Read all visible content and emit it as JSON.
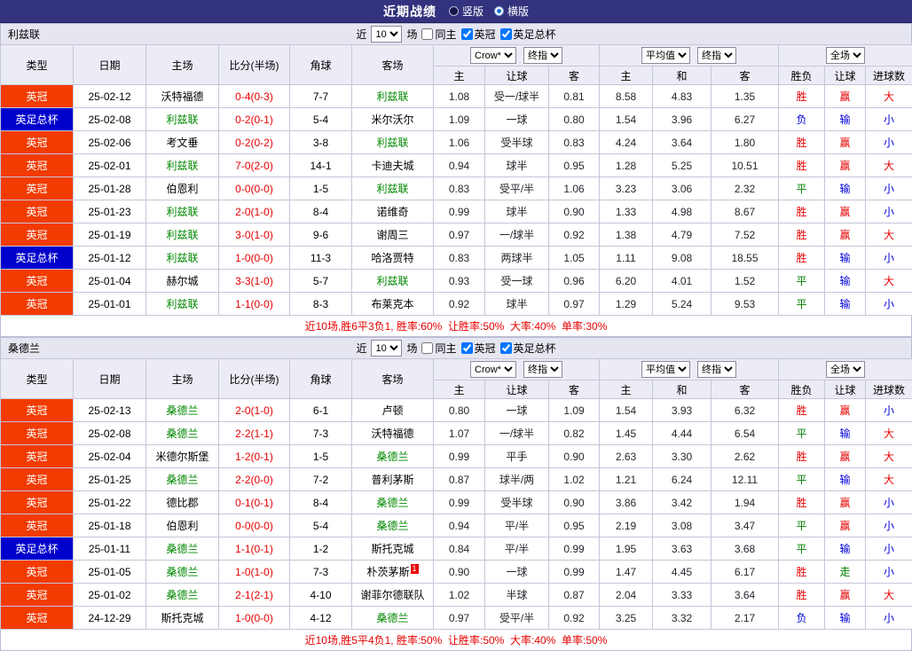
{
  "title_bar": {
    "title": "近期战绩",
    "radios": [
      {
        "label": "竖版",
        "selected": false
      },
      {
        "label": "横版",
        "selected": true
      }
    ]
  },
  "filter_bar": {
    "near_label": "近",
    "count_value": "10",
    "games_label": "场",
    "checkboxes": [
      {
        "label": "同主",
        "checked": false
      },
      {
        "label": "英冠",
        "checked": true,
        "checked_attr": "checked"
      },
      {
        "label": "英足总杯",
        "checked": true,
        "checked_attr": "checked"
      }
    ]
  },
  "table_header": {
    "main_cols": [
      "类型",
      "日期",
      "主场",
      "比分(半场)",
      "角球",
      "客场"
    ],
    "sub_cols": [
      "主",
      "让球",
      "客",
      "主",
      "和",
      "客",
      "胜负",
      "让球",
      "进球数"
    ],
    "odds_source_select": "Crow*",
    "odds_time_select": "终指",
    "euro_source_select": "平均值",
    "euro_time_select": "终指",
    "scope_select": "全场"
  },
  "colors": {
    "topbar_bg": "#32327e",
    "league_badge": "#f23b00",
    "cup_badge": "#0000cc",
    "team_highlight": "#008800",
    "score_text": "#e60000",
    "summary_text": "#e60000"
  },
  "type_colors": {
    "英冠": "#f23b00",
    "英足总杯": "#0000cc"
  },
  "result_colors": {
    "胜": "#e60000",
    "平": "#008000",
    "负": "#0000dd",
    "赢": "#e60000",
    "输": "#0000dd",
    "走": "#008000",
    "大": "#e60000",
    "小": "#0000dd"
  },
  "sections": [
    {
      "team": "利兹联",
      "rows": [
        {
          "type": "英冠",
          "date": "25-02-12",
          "home": "沃特福德",
          "home_self": false,
          "score": "0-4(0-3)",
          "corners": "7-7",
          "away": "利兹联",
          "away_self": true,
          "asia": [
            "1.08",
            "受一/球半",
            "0.81"
          ],
          "euro": [
            "8.58",
            "4.83",
            "1.35"
          ],
          "results": [
            "胜",
            "赢",
            "大"
          ]
        },
        {
          "type": "英足总杯",
          "date": "25-02-08",
          "home": "利兹联",
          "home_self": true,
          "score": "0-2(0-1)",
          "corners": "5-4",
          "away": "米尔沃尔",
          "away_self": false,
          "asia": [
            "1.09",
            "一球",
            "0.80"
          ],
          "euro": [
            "1.54",
            "3.96",
            "6.27"
          ],
          "results": [
            "负",
            "输",
            "小"
          ]
        },
        {
          "type": "英冠",
          "date": "25-02-06",
          "home": "考文垂",
          "home_self": false,
          "score": "0-2(0-2)",
          "corners": "3-8",
          "away": "利兹联",
          "away_self": true,
          "asia": [
            "1.06",
            "受半球",
            "0.83"
          ],
          "euro": [
            "4.24",
            "3.64",
            "1.80"
          ],
          "results": [
            "胜",
            "赢",
            "小"
          ]
        },
        {
          "type": "英冠",
          "date": "25-02-01",
          "home": "利兹联",
          "home_self": true,
          "score": "7-0(2-0)",
          "corners": "14-1",
          "away": "卡迪夫城",
          "away_self": false,
          "asia": [
            "0.94",
            "球半",
            "0.95"
          ],
          "euro": [
            "1.28",
            "5.25",
            "10.51"
          ],
          "results": [
            "胜",
            "赢",
            "大"
          ]
        },
        {
          "type": "英冠",
          "date": "25-01-28",
          "home": "伯恩利",
          "home_self": false,
          "score": "0-0(0-0)",
          "corners": "1-5",
          "away": "利兹联",
          "away_self": true,
          "asia": [
            "0.83",
            "受平/半",
            "1.06"
          ],
          "euro": [
            "3.23",
            "3.06",
            "2.32"
          ],
          "results": [
            "平",
            "输",
            "小"
          ]
        },
        {
          "type": "英冠",
          "date": "25-01-23",
          "home": "利兹联",
          "home_self": true,
          "score": "2-0(1-0)",
          "corners": "8-4",
          "away": "诺维奇",
          "away_self": false,
          "asia": [
            "0.99",
            "球半",
            "0.90"
          ],
          "euro": [
            "1.33",
            "4.98",
            "8.67"
          ],
          "results": [
            "胜",
            "赢",
            "小"
          ]
        },
        {
          "type": "英冠",
          "date": "25-01-19",
          "home": "利兹联",
          "home_self": true,
          "score": "3-0(1-0)",
          "corners": "9-6",
          "away": "谢周三",
          "away_self": false,
          "asia": [
            "0.97",
            "一/球半",
            "0.92"
          ],
          "euro": [
            "1.38",
            "4.79",
            "7.52"
          ],
          "results": [
            "胜",
            "赢",
            "大"
          ]
        },
        {
          "type": "英足总杯",
          "date": "25-01-12",
          "home": "利兹联",
          "home_self": true,
          "score": "1-0(0-0)",
          "corners": "11-3",
          "away": "哈洛贾特",
          "away_self": false,
          "asia": [
            "0.83",
            "两球半",
            "1.05"
          ],
          "euro": [
            "1.11",
            "9.08",
            "18.55"
          ],
          "results": [
            "胜",
            "输",
            "小"
          ]
        },
        {
          "type": "英冠",
          "date": "25-01-04",
          "home": "赫尔城",
          "home_self": false,
          "score": "3-3(1-0)",
          "corners": "5-7",
          "away": "利兹联",
          "away_self": true,
          "asia": [
            "0.93",
            "受一球",
            "0.96"
          ],
          "euro": [
            "6.20",
            "4.01",
            "1.52"
          ],
          "results": [
            "平",
            "输",
            "大"
          ]
        },
        {
          "type": "英冠",
          "date": "25-01-01",
          "home": "利兹联",
          "home_self": true,
          "score": "1-1(0-0)",
          "corners": "8-3",
          "away": "布莱克本",
          "away_self": false,
          "asia": [
            "0.92",
            "球半",
            "0.97"
          ],
          "euro": [
            "1.29",
            "5.24",
            "9.53"
          ],
          "results": [
            "平",
            "输",
            "小"
          ]
        }
      ],
      "summary": "近10场,胜6平3负1, 胜率:60%  让胜率:50%  大率:40%  单率:30%"
    },
    {
      "team": "桑德兰",
      "rows": [
        {
          "type": "英冠",
          "date": "25-02-13",
          "home": "桑德兰",
          "home_self": true,
          "score": "2-0(1-0)",
          "corners": "6-1",
          "away": "卢顿",
          "away_self": false,
          "asia": [
            "0.80",
            "一球",
            "1.09"
          ],
          "euro": [
            "1.54",
            "3.93",
            "6.32"
          ],
          "results": [
            "胜",
            "赢",
            "小"
          ]
        },
        {
          "type": "英冠",
          "date": "25-02-08",
          "home": "桑德兰",
          "home_self": true,
          "score": "2-2(1-1)",
          "corners": "7-3",
          "away": "沃特福德",
          "away_self": false,
          "asia": [
            "1.07",
            "一/球半",
            "0.82"
          ],
          "euro": [
            "1.45",
            "4.44",
            "6.54"
          ],
          "results": [
            "平",
            "输",
            "大"
          ]
        },
        {
          "type": "英冠",
          "date": "25-02-04",
          "home": "米德尔斯堡",
          "home_self": false,
          "score": "1-2(0-1)",
          "corners": "1-5",
          "away": "桑德兰",
          "away_self": true,
          "asia": [
            "0.99",
            "平手",
            "0.90"
          ],
          "euro": [
            "2.63",
            "3.30",
            "2.62"
          ],
          "results": [
            "胜",
            "赢",
            "大"
          ]
        },
        {
          "type": "英冠",
          "date": "25-01-25",
          "home": "桑德兰",
          "home_self": true,
          "score": "2-2(0-0)",
          "corners": "7-2",
          "away": "普利茅斯",
          "away_self": false,
          "asia": [
            "0.87",
            "球半/两",
            "1.02"
          ],
          "euro": [
            "1.21",
            "6.24",
            "12.11"
          ],
          "results": [
            "平",
            "输",
            "大"
          ]
        },
        {
          "type": "英冠",
          "date": "25-01-22",
          "home": "德比郡",
          "home_self": false,
          "score": "0-1(0-1)",
          "corners": "8-4",
          "away": "桑德兰",
          "away_self": true,
          "asia": [
            "0.99",
            "受半球",
            "0.90"
          ],
          "euro": [
            "3.86",
            "3.42",
            "1.94"
          ],
          "results": [
            "胜",
            "赢",
            "小"
          ]
        },
        {
          "type": "英冠",
          "date": "25-01-18",
          "home": "伯恩利",
          "home_self": false,
          "score": "0-0(0-0)",
          "corners": "5-4",
          "away": "桑德兰",
          "away_self": true,
          "asia": [
            "0.94",
            "平/半",
            "0.95"
          ],
          "euro": [
            "2.19",
            "3.08",
            "3.47"
          ],
          "results": [
            "平",
            "赢",
            "小"
          ]
        },
        {
          "type": "英足总杯",
          "date": "25-01-11",
          "home": "桑德兰",
          "home_self": true,
          "score": "1-1(0-1)",
          "corners": "1-2",
          "away": "斯托克城",
          "away_self": false,
          "asia": [
            "0.84",
            "平/半",
            "0.99"
          ],
          "euro": [
            "1.95",
            "3.63",
            "3.68"
          ],
          "results": [
            "平",
            "输",
            "小"
          ]
        },
        {
          "type": "英冠",
          "date": "25-01-05",
          "home": "桑德兰",
          "home_self": true,
          "score": "1-0(1-0)",
          "corners": "7-3",
          "away": "朴茨茅斯",
          "away_self": false,
          "away_red_cards": "1",
          "asia": [
            "0.90",
            "一球",
            "0.99"
          ],
          "euro": [
            "1.47",
            "4.45",
            "6.17"
          ],
          "results": [
            "胜",
            "走",
            "小"
          ]
        },
        {
          "type": "英冠",
          "date": "25-01-02",
          "home": "桑德兰",
          "home_self": true,
          "score": "2-1(2-1)",
          "corners": "4-10",
          "away": "谢菲尔德联队",
          "away_self": false,
          "asia": [
            "1.02",
            "半球",
            "0.87"
          ],
          "euro": [
            "2.04",
            "3.33",
            "3.64"
          ],
          "results": [
            "胜",
            "赢",
            "大"
          ]
        },
        {
          "type": "英冠",
          "date": "24-12-29",
          "home": "斯托克城",
          "home_self": false,
          "score": "1-0(0-0)",
          "corners": "4-12",
          "away": "桑德兰",
          "away_self": true,
          "asia": [
            "0.97",
            "受平/半",
            "0.92"
          ],
          "euro": [
            "3.25",
            "3.32",
            "2.17"
          ],
          "results": [
            "负",
            "输",
            "小"
          ]
        }
      ],
      "summary": "近10场,胜5平4负1, 胜率:50%  让胜率:50%  大率:40%  单率:50%"
    }
  ]
}
